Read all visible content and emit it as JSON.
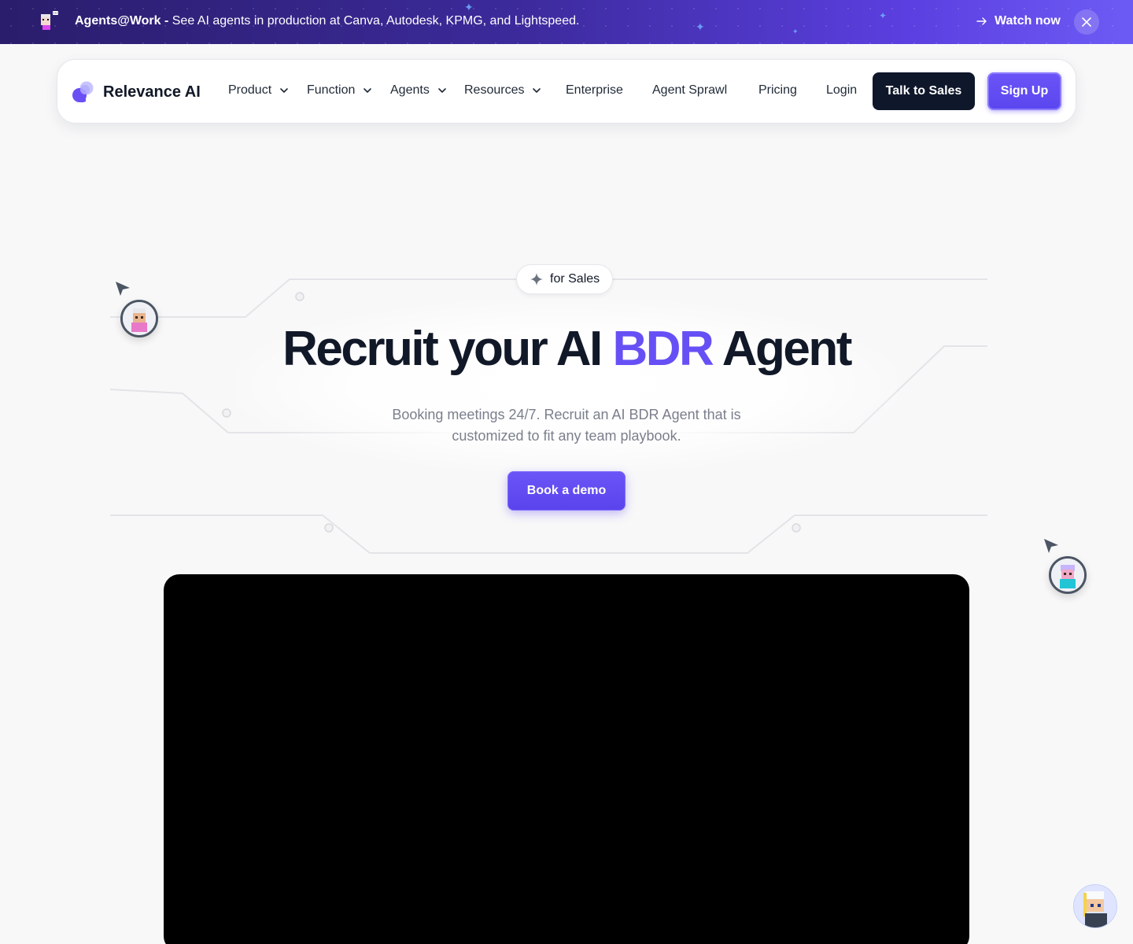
{
  "announcement": {
    "bold_label": "Agents@Work -",
    "message": " See AI agents in production at Canva, Autodesk, KPMG, and Lightspeed.",
    "cta_label": "Watch now",
    "avatar_icon": "pixel-agent-avatar",
    "close_icon": "close-icon"
  },
  "nav": {
    "brand": "Relevance AI",
    "items": [
      {
        "label": "Product",
        "has_dropdown": true
      },
      {
        "label": "Function",
        "has_dropdown": true
      },
      {
        "label": "Agents",
        "has_dropdown": true
      },
      {
        "label": "Resources",
        "has_dropdown": true
      },
      {
        "label": "Enterprise",
        "has_dropdown": false
      },
      {
        "label": "Agent Sprawl",
        "has_dropdown": false
      },
      {
        "label": "Pricing",
        "has_dropdown": false
      }
    ],
    "login_label": "Login",
    "talk_to_sales_label": "Talk to Sales",
    "signup_label": "Sign Up"
  },
  "hero": {
    "badge_label": "for Sales",
    "title_part1": "Recruit your AI ",
    "title_accent": "BDR",
    "title_part2": " Agent",
    "subtitle": "Booking meetings 24/7. Recruit an AI BDR Agent that is customized to fit any team playbook.",
    "cta_label": "Book a demo"
  },
  "colors": {
    "accent": "#6650f5",
    "dark_button": "#0f172a",
    "announcement_start": "#2a1d6b",
    "announcement_end": "#6d5bf5"
  }
}
